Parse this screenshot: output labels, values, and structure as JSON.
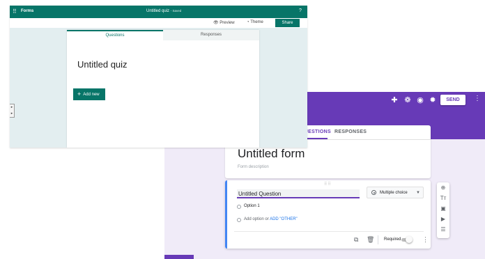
{
  "google_forms": {
    "header": {
      "icons": [
        "puzzle-icon",
        "palette-icon",
        "eye-icon",
        "gear-icon"
      ],
      "send_label": "SEND",
      "more_glyph": "⋮"
    },
    "tabs": {
      "questions": "QUESTIONS",
      "responses": "RESPONSES"
    },
    "form": {
      "title": "Untitled form",
      "description": "Form description"
    },
    "question": {
      "title": "Untitled Question",
      "type": "Multiple choice",
      "options": [
        "Option 1"
      ],
      "add_option": "Add option",
      "or": "or",
      "add_other": "ADD \"OTHER\"",
      "required_label": "Required"
    },
    "side_tools": [
      "add-question-icon",
      "title-icon",
      "image-icon",
      "video-icon",
      "section-icon"
    ],
    "accent_color": "#673ab7",
    "background_color": "#f0ebf8"
  },
  "ms_forms": {
    "app_name": "Forms",
    "doc_title": "Untitled quiz",
    "doc_status": "- Saved",
    "help_glyph": "?",
    "toolbar": {
      "preview": "Preview",
      "theme": "Theme",
      "share": "Share"
    },
    "tabs": {
      "questions": "Questions",
      "responses": "Responses"
    },
    "quiz_title": "Untitled quiz",
    "add_new_label": "Add new",
    "accent_color": "#077568"
  }
}
